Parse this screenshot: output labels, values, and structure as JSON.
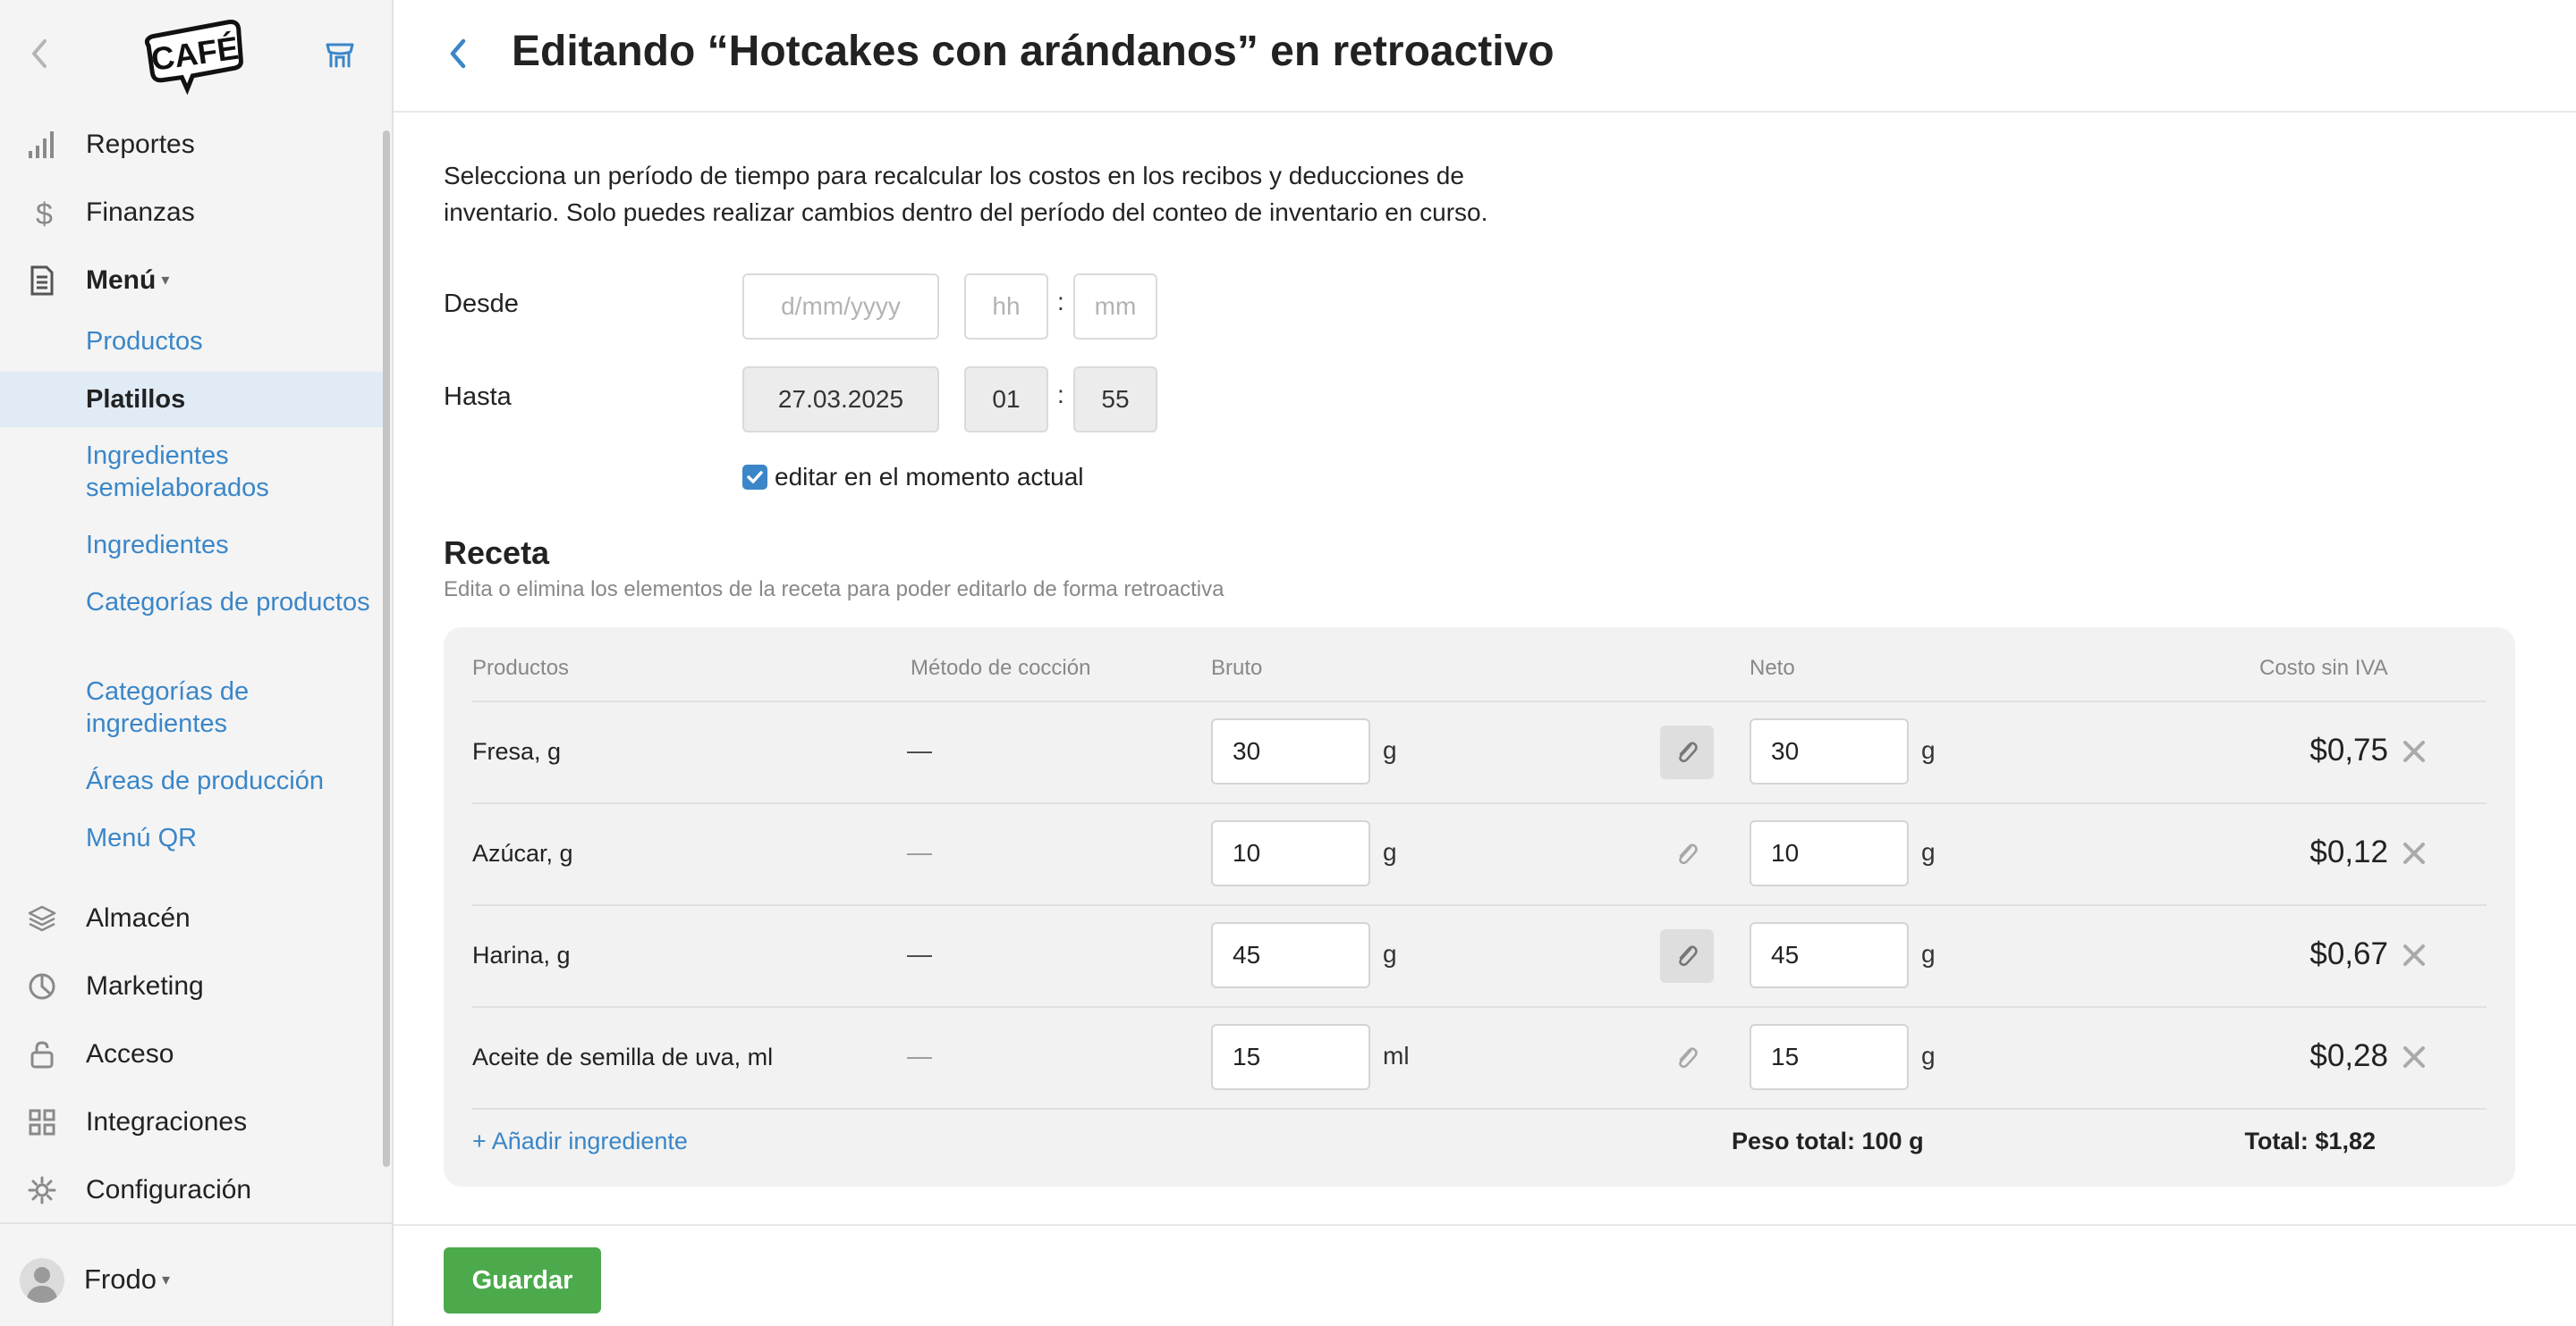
{
  "sidebar": {
    "logo_text": "CAFÉ",
    "back_icon": "chevron-left-icon",
    "store_icon": "store-icon",
    "nav": [
      {
        "label": "Reportes",
        "icon": "bar-chart-icon"
      },
      {
        "label": "Finanzas",
        "icon": "dollar-icon"
      },
      {
        "label": "Menú",
        "icon": "document-icon",
        "caret": "▾"
      },
      {
        "label": "Almacén",
        "icon": "layers-icon"
      },
      {
        "label": "Marketing",
        "icon": "pie-icon"
      },
      {
        "label": "Acceso",
        "icon": "lock-icon"
      },
      {
        "label": "Integraciones",
        "icon": "grid-icon"
      },
      {
        "label": "Configuración",
        "icon": "gear-icon"
      }
    ],
    "submenu": [
      {
        "label": "Productos"
      },
      {
        "label": "Platillos"
      },
      {
        "label": "Ingredientes semielaborados"
      },
      {
        "label": "Ingredientes"
      },
      {
        "label": "Categorías de productos"
      },
      {
        "label": "Categorías de ingredientes"
      },
      {
        "label": "Áreas de producción"
      },
      {
        "label": "Menú QR"
      }
    ],
    "user": {
      "name": "Frodo",
      "caret": "▾"
    }
  },
  "header": {
    "title": "Editando “Hotcakes con arándanos” en retroactivo"
  },
  "intro": "Selecciona un período de tiempo para recalcular los costos en los recibos y deducciones de inventario. Solo puedes realizar cambios dentro del período del conteo de inventario en curso.",
  "period": {
    "from_label": "Desde",
    "from_date_placeholder": "d/mm/yyyy",
    "from_hour_placeholder": "hh",
    "from_minute_placeholder": "mm",
    "to_label": "Hasta",
    "to_date": "27.03.2025",
    "to_hour": "01",
    "to_minute": "55",
    "separator": ":",
    "edit_now_label": "editar en el momento actual",
    "edit_now_checked": true
  },
  "recipe": {
    "title": "Receta",
    "subtitle": "Edita o elimina los elementos de la receta para poder editarlo de forma retroactiva",
    "columns": [
      "Productos",
      "Método de cocción",
      "Bruto",
      "Neto",
      "Costo sin IVA"
    ],
    "rows": [
      {
        "product": "Fresa, g",
        "method": "—",
        "gross": "30",
        "gross_unit": "g",
        "clip_active": true,
        "net": "30",
        "net_unit": "g",
        "cost": "$0,75"
      },
      {
        "product": "Azúcar, g",
        "method": "—",
        "gross": "10",
        "gross_unit": "g",
        "clip_active": false,
        "net": "10",
        "net_unit": "g",
        "cost": "$0,12"
      },
      {
        "product": "Harina, g",
        "method": "—",
        "gross": "45",
        "gross_unit": "g",
        "clip_active": true,
        "net": "45",
        "net_unit": "g",
        "cost": "$0,67"
      },
      {
        "product": "Aceite de semilla de uva, ml",
        "method": "—",
        "gross": "15",
        "gross_unit": "ml",
        "clip_active": false,
        "net": "15",
        "net_unit": "g",
        "cost": "$0,28"
      }
    ],
    "add_label": "+ Añadir ingrediente",
    "total_weight": "Peso total: 100 g",
    "total_cost": "Total: $1,82"
  },
  "footer": {
    "save_label": "Guardar"
  },
  "colors": {
    "accent": "#3a86c8",
    "save": "#4caa4c",
    "active_bg": "#e0ebf6"
  }
}
